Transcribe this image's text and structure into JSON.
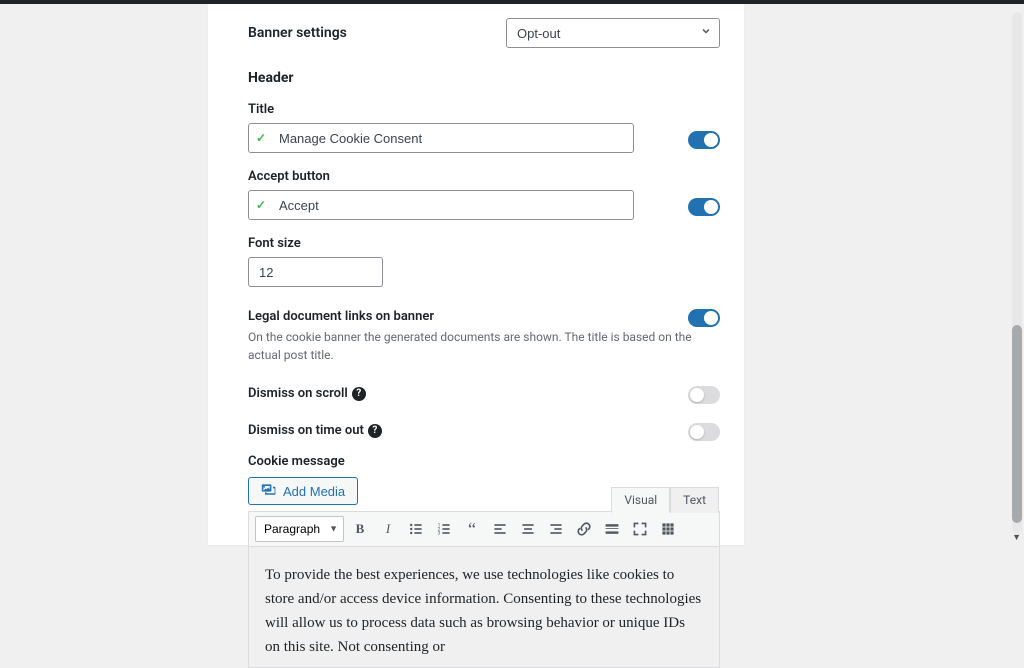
{
  "banner_settings": {
    "label": "Banner settings",
    "select": {
      "value": "Opt-out",
      "options": [
        "Opt-out"
      ]
    }
  },
  "header": {
    "section_title": "Header"
  },
  "title_field": {
    "label": "Title",
    "value": "Manage Cookie Consent",
    "toggle": true
  },
  "accept_button": {
    "label": "Accept button",
    "value": "Accept",
    "toggle": true
  },
  "font_size": {
    "label": "Font size",
    "value": "12"
  },
  "legal_links": {
    "label": "Legal document links on banner",
    "help": "On the cookie banner the generated documents are shown. The title is based on the actual post title.",
    "toggle": true
  },
  "dismiss_scroll": {
    "label": "Dismiss on scroll",
    "toggle": false
  },
  "dismiss_timeout": {
    "label": "Dismiss on time out",
    "toggle": false
  },
  "cookie_message": {
    "label": "Cookie message",
    "add_media": "Add Media",
    "tabs": {
      "visual": "Visual",
      "text": "Text"
    },
    "format_select": "Paragraph",
    "body": "To provide the best experiences, we use technologies like cookies to store and/or access device information. Consenting to these technologies will allow us to process data such as browsing behavior or unique IDs on this site. Not consenting or"
  }
}
